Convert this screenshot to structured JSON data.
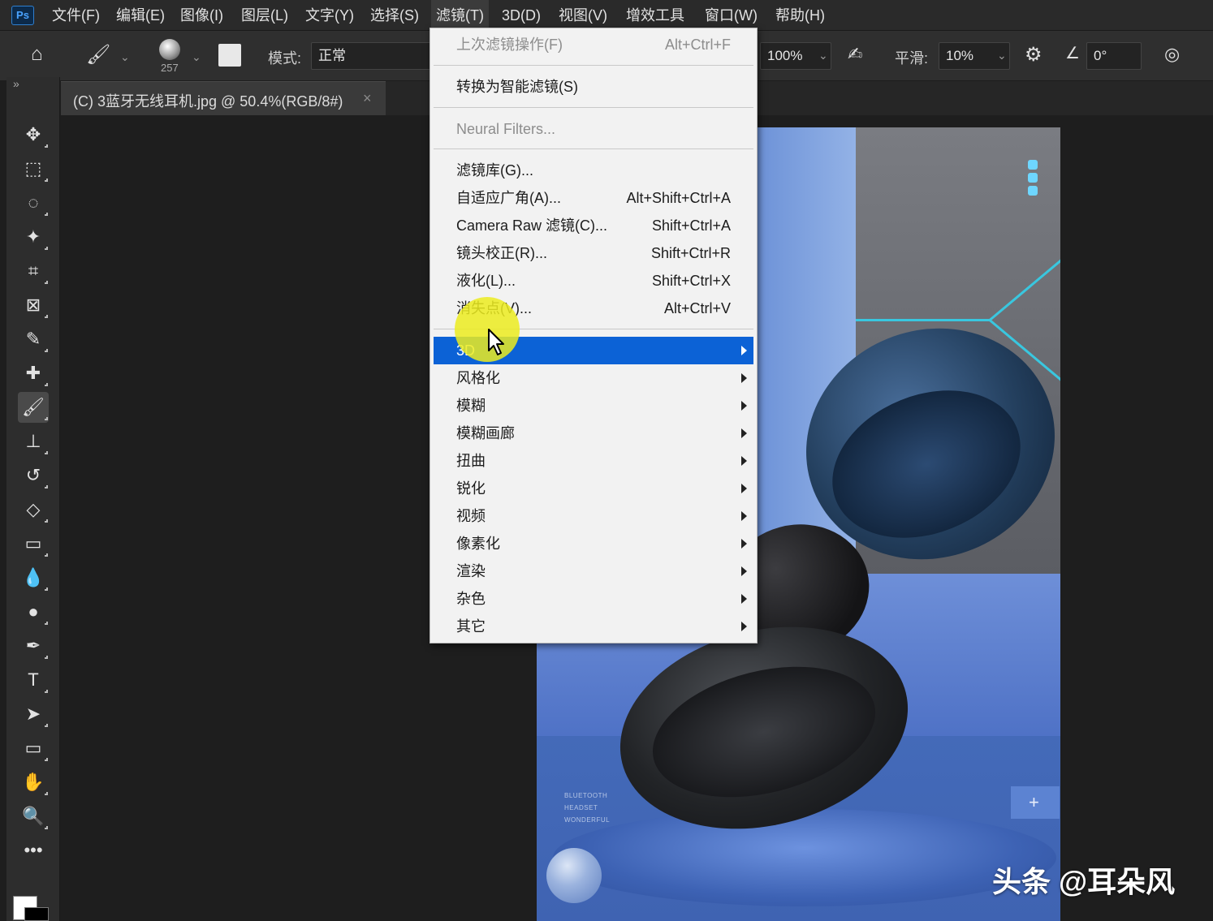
{
  "app": {
    "logo": "Ps"
  },
  "menubar": {
    "items": [
      {
        "label": "文件(F)"
      },
      {
        "label": "编辑(E)"
      },
      {
        "label": "图像(I)"
      },
      {
        "label": "图层(L)"
      },
      {
        "label": "文字(Y)"
      },
      {
        "label": "选择(S)"
      },
      {
        "label": "滤镜(T)"
      },
      {
        "label": "3D(D)"
      },
      {
        "label": "视图(V)"
      },
      {
        "label": "增效工具"
      },
      {
        "label": "窗口(W)"
      },
      {
        "label": "帮助(H)"
      }
    ],
    "active": "滤镜(T)"
  },
  "optionsbar": {
    "brush_size": "257",
    "mode_label": "模式:",
    "mode_value": "正常",
    "opacity_value": "100%",
    "smoothing_label": "平滑:",
    "smoothing_value": "10%",
    "angle_value": "0°"
  },
  "document": {
    "tab_title": "(C) 3蓝牙无线耳机.jpg @ 50.4%(RGB/8#)",
    "close_glyph": "×"
  },
  "toolbox": {
    "collapse_glyph": "»",
    "tools": [
      {
        "name": "move-tool",
        "glyph": "✥"
      },
      {
        "name": "marquee-tool",
        "glyph": "⬚"
      },
      {
        "name": "lasso-tool",
        "glyph": "◌"
      },
      {
        "name": "magic-wand-tool",
        "glyph": "✦"
      },
      {
        "name": "crop-tool",
        "glyph": "⌗"
      },
      {
        "name": "frame-tool",
        "glyph": "⊠"
      },
      {
        "name": "eyedropper-tool",
        "glyph": "✎"
      },
      {
        "name": "healing-brush-tool",
        "glyph": "✚"
      },
      {
        "name": "brush-tool",
        "glyph": "🖌"
      },
      {
        "name": "clone-stamp-tool",
        "glyph": "⊥"
      },
      {
        "name": "history-brush-tool",
        "glyph": "↺"
      },
      {
        "name": "eraser-tool",
        "glyph": "◇"
      },
      {
        "name": "gradient-tool",
        "glyph": "▭"
      },
      {
        "name": "blur-tool",
        "glyph": "💧"
      },
      {
        "name": "dodge-tool",
        "glyph": "●"
      },
      {
        "name": "pen-tool",
        "glyph": "✒"
      },
      {
        "name": "type-tool",
        "glyph": "T"
      },
      {
        "name": "path-selection-tool",
        "glyph": "➤"
      },
      {
        "name": "rectangle-tool",
        "glyph": "▭"
      },
      {
        "name": "hand-tool",
        "glyph": "✋"
      },
      {
        "name": "zoom-tool",
        "glyph": "🔍"
      },
      {
        "name": "more-tools",
        "glyph": "•••"
      }
    ],
    "active_tool": "brush-tool",
    "foreground_color": "#ffffff",
    "background_color": "#000000"
  },
  "filter_menu": {
    "items": [
      {
        "label": "上次滤镜操作(F)",
        "shortcut": "Alt+Ctrl+F",
        "disabled": true
      },
      {
        "label": "转换为智能滤镜(S)"
      },
      {
        "label": "Neural Filters...",
        "disabled": true
      },
      {
        "label": "滤镜库(G)..."
      },
      {
        "label": "自适应广角(A)...",
        "shortcut": "Alt+Shift+Ctrl+A"
      },
      {
        "label": "Camera Raw 滤镜(C)...",
        "shortcut": "Shift+Ctrl+A"
      },
      {
        "label": "镜头校正(R)...",
        "shortcut": "Shift+Ctrl+R"
      },
      {
        "label": "液化(L)...",
        "shortcut": "Shift+Ctrl+X"
      },
      {
        "label": "消失点(V)...",
        "shortcut": "Alt+Ctrl+V"
      },
      {
        "label": "3D",
        "submenu": true,
        "highlighted": true
      },
      {
        "label": "风格化",
        "submenu": true
      },
      {
        "label": "模糊",
        "submenu": true
      },
      {
        "label": "模糊画廊",
        "submenu": true
      },
      {
        "label": "扭曲",
        "submenu": true
      },
      {
        "label": "锐化",
        "submenu": true
      },
      {
        "label": "视频",
        "submenu": true
      },
      {
        "label": "像素化",
        "submenu": true
      },
      {
        "label": "渲染",
        "submenu": true
      },
      {
        "label": "杂色",
        "submenu": true
      },
      {
        "label": "其它",
        "submenu": true
      }
    ]
  },
  "canvas": {
    "small_text_lines": [
      "BLUETOOTH",
      "HEADSET",
      "WONDERFUL"
    ],
    "plus_glyph": "+"
  },
  "watermark": "头条 @耳朵风",
  "colors": {
    "menu_highlight": "#0c62d6",
    "cursor_highlight": "#ecec20",
    "accent_cyan": "#39c7df"
  }
}
